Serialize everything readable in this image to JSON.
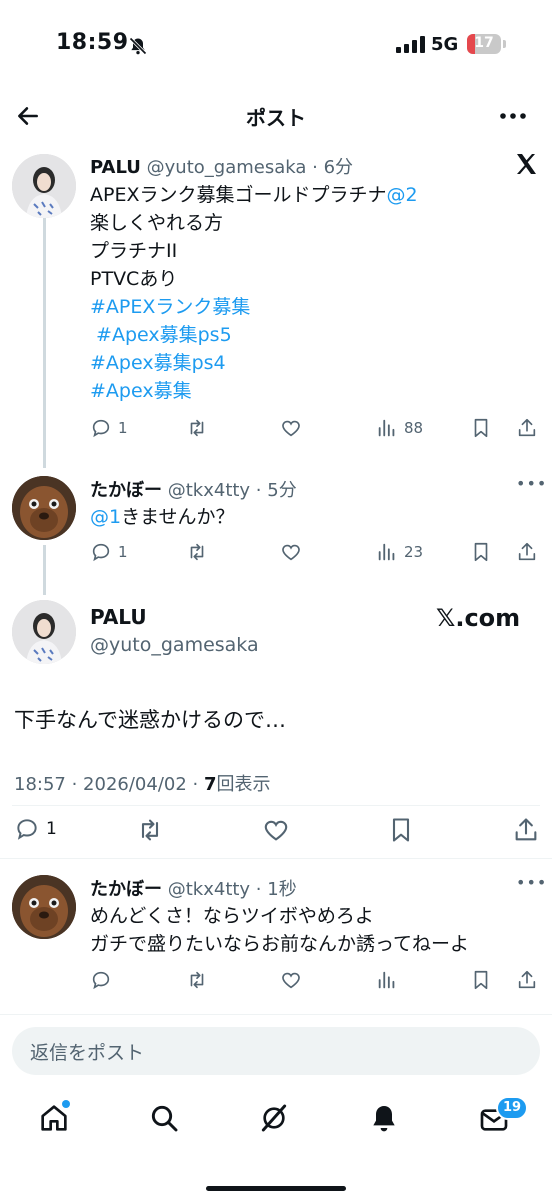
{
  "status_bar": {
    "time": "18:59",
    "network": "5G",
    "battery": "17"
  },
  "header": {
    "title": "ポスト"
  },
  "thread": [
    {
      "display_name": "PALU",
      "handle_time": "@yuto_gamesaka · 6分",
      "lines": [
        {
          "parts": [
            {
              "text": "APEXランク募集ゴールドプラチナ",
              "link": false
            },
            {
              "text": "@2",
              "link": true
            }
          ]
        },
        {
          "parts": [
            {
              "text": "楽しくやれる方",
              "link": false
            }
          ]
        },
        {
          "parts": [
            {
              "text": "プラチナII",
              "link": false
            }
          ]
        },
        {
          "parts": [
            {
              "text": "PTVCあり",
              "link": false
            }
          ]
        },
        {
          "parts": [
            {
              "text": "#APEXランク募集",
              "link": true
            }
          ]
        },
        {
          "parts": [
            {
              "text": " #Apex募集ps5",
              "link": true
            }
          ]
        },
        {
          "parts": [
            {
              "text": "#Apex募集ps4",
              "link": true
            }
          ]
        },
        {
          "parts": [
            {
              "text": "#Apex募集",
              "link": true
            }
          ]
        }
      ],
      "replies": "1",
      "views": "88"
    },
    {
      "display_name": "たかぼー",
      "handle_time": "@tkx4tty · 5分",
      "lines": [
        {
          "parts": [
            {
              "text": "@1",
              "link": true
            },
            {
              "text": "きませんか？",
              "link": false
            }
          ]
        }
      ],
      "replies": "1",
      "views": "23"
    }
  ],
  "main_post": {
    "display_name": "PALU",
    "handle": "@yuto_gamesaka",
    "source_logo": "𝕏.com",
    "text": "下手なんで迷惑かけるので…",
    "timestamp": "18:57 · 2026/04/02 · ",
    "views_count": "7",
    "views_label": "回表示",
    "replies": "1"
  },
  "reply_post": {
    "display_name": "たかぼー",
    "handle_time": "@tkx4tty · 1秒",
    "line1": "めんどくさ！ならツイボやめろよ",
    "line2": "ガチで盛りたいならお前なんか誘ってねーよ"
  },
  "composer": {
    "placeholder": "返信をポスト"
  },
  "bottom_nav": {
    "messages_badge": "19"
  },
  "colors": {
    "link": "#1d9bf0",
    "muted": "#536471",
    "text": "#0f1419"
  },
  "icons": [
    "back-arrow-icon",
    "more-icon",
    "x-logo-icon",
    "reply-icon",
    "retweet-icon",
    "like-icon",
    "views-icon",
    "bookmark-icon",
    "share-icon",
    "home-icon",
    "search-icon",
    "grok-icon",
    "notifications-icon",
    "messages-icon"
  ]
}
